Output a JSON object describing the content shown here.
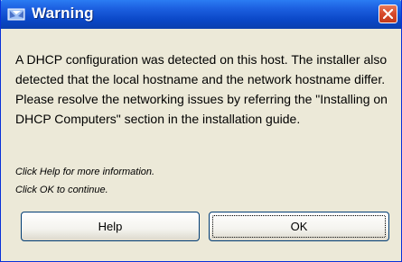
{
  "dialog": {
    "title": "Warning",
    "title_icon": "java-cup-icon",
    "close_icon": "close-icon",
    "message": "A DHCP configuration was detected on this host. The installer also detected that the local hostname and the network hostname differ. Please resolve the networking issues by referring the \"Installing on DHCP Computers\" section in the installation guide.",
    "hint_help": "Click Help for more information.",
    "hint_ok": "Click OK to continue.",
    "buttons": {
      "help_label": "Help",
      "ok_label": "OK"
    },
    "colors": {
      "titlebar": "#0a47c6",
      "background": "#ece9d8",
      "close_button": "#d6482a"
    }
  }
}
